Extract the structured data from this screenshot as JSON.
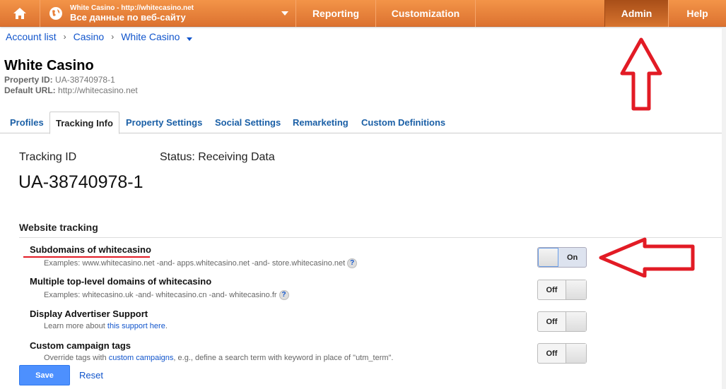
{
  "topbar": {
    "account_line1": "White Casino - http://whitecasino.net",
    "account_line2": "Все данные по веб-сайту",
    "reporting": "Reporting",
    "customization": "Customization",
    "admin": "Admin",
    "help": "Help"
  },
  "breadcrumb": [
    "Account list",
    "Casino",
    "White Casino"
  ],
  "property": {
    "title": "White Casino",
    "id_label": "Property ID:",
    "id_value": "UA-38740978-1",
    "url_label": "Default URL:",
    "url_value": "http://whitecasino.net"
  },
  "tabs": [
    "Profiles",
    "Tracking Info",
    "Property Settings",
    "Social Settings",
    "Remarketing",
    "Custom Definitions"
  ],
  "tracking": {
    "label": "Tracking ID",
    "status": "Status: Receiving Data",
    "id": "UA-38740978-1"
  },
  "section": "Website tracking",
  "options": [
    {
      "title": "Subdomains of whitecasino",
      "desc": "Examples: www.whitecasino.net -and- apps.whitecasino.net -and- store.whitecasino.net",
      "state": "On"
    },
    {
      "title": "Multiple top-level domains of whitecasino",
      "desc": "Examples: whitecasino.uk -and- whitecasino.cn -and- whitecasino.fr",
      "state": "Off"
    },
    {
      "title": "Display Advertiser Support",
      "desc_pre": "Learn more about ",
      "desc_link": "this support here",
      "desc_post": ".",
      "state": "Off"
    },
    {
      "title": "Custom campaign tags",
      "desc_pre": "Override tags with ",
      "desc_link": "custom campaigns",
      "desc_post": ", e.g., define a search term with keyword in place of \"utm_term\".",
      "state": "Off"
    }
  ],
  "buttons": {
    "save": "Save",
    "reset": "Reset"
  },
  "colors": {
    "brand": "#e8823b",
    "link": "#1155cc",
    "annotation": "#e21b25"
  }
}
